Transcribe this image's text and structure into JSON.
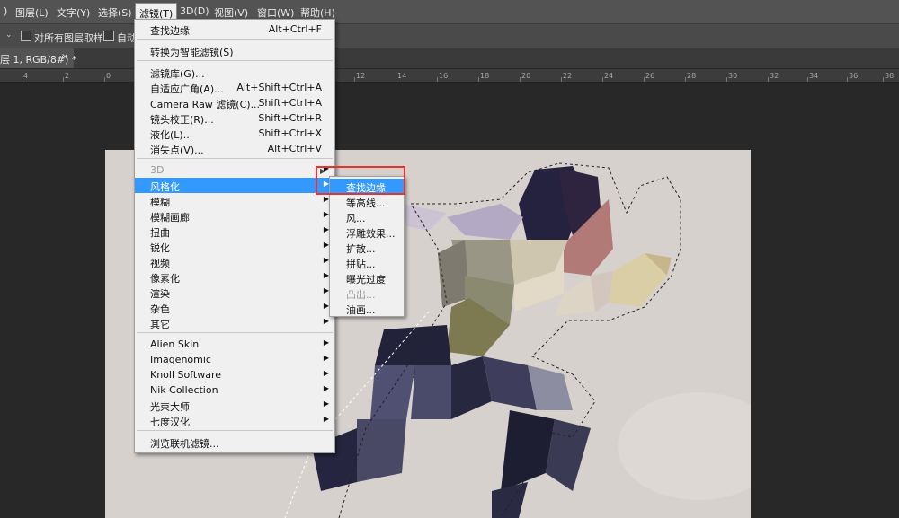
{
  "menubar": {
    "items": [
      ")",
      "图层(L)",
      "文字(Y)",
      "选择(S)",
      "滤镜(T)",
      "3D(D)",
      "视图(V)",
      "窗口(W)",
      "帮助(H)"
    ]
  },
  "options_bar": {
    "sample_all_layers": "对所有图层取样",
    "auto_label": "自动"
  },
  "tab": {
    "title": "层 1, RGB/8#) *",
    "close": "×"
  },
  "ruler": {
    "ticks": [
      "4",
      "2",
      "0",
      "12",
      "14",
      "16",
      "18",
      "20",
      "22",
      "24",
      "26",
      "28",
      "30",
      "32",
      "34",
      "36",
      "38"
    ]
  },
  "filter_menu": {
    "items": [
      {
        "label": "查找边缘",
        "shortcut": "Alt+Ctrl+F"
      },
      {
        "label": "转换为智能滤镜(S)",
        "shortcut": ""
      },
      {
        "label": "滤镜库(G)...",
        "shortcut": ""
      },
      {
        "label": "自适应广角(A)...",
        "shortcut": "Alt+Shift+Ctrl+A"
      },
      {
        "label": "Camera Raw 滤镜(C)...",
        "shortcut": "Shift+Ctrl+A"
      },
      {
        "label": "镜头校正(R)...",
        "shortcut": "Shift+Ctrl+R"
      },
      {
        "label": "液化(L)...",
        "shortcut": "Shift+Ctrl+X"
      },
      {
        "label": "消失点(V)...",
        "shortcut": "Alt+Ctrl+V"
      },
      {
        "label": "3D",
        "shortcut": ""
      },
      {
        "label": "风格化",
        "shortcut": ""
      },
      {
        "label": "模糊",
        "shortcut": ""
      },
      {
        "label": "模糊画廊",
        "shortcut": ""
      },
      {
        "label": "扭曲",
        "shortcut": ""
      },
      {
        "label": "锐化",
        "shortcut": ""
      },
      {
        "label": "视频",
        "shortcut": ""
      },
      {
        "label": "像素化",
        "shortcut": ""
      },
      {
        "label": "渲染",
        "shortcut": ""
      },
      {
        "label": "杂色",
        "shortcut": ""
      },
      {
        "label": "其它",
        "shortcut": ""
      },
      {
        "label": "Alien Skin",
        "shortcut": ""
      },
      {
        "label": "Imagenomic",
        "shortcut": ""
      },
      {
        "label": "Knoll Software",
        "shortcut": ""
      },
      {
        "label": "Nik Collection",
        "shortcut": ""
      },
      {
        "label": "光束大师",
        "shortcut": ""
      },
      {
        "label": "七度汉化",
        "shortcut": ""
      },
      {
        "label": "浏览联机滤镜...",
        "shortcut": ""
      }
    ]
  },
  "stylize_submenu": {
    "items": [
      "查找边缘",
      "等高线...",
      "风...",
      "浮雕效果...",
      "扩散...",
      "拼贴...",
      "曝光过度",
      "凸出...",
      "油画..."
    ]
  },
  "colors": {
    "highlight": "#3399ff",
    "callout": "#e8322f"
  }
}
